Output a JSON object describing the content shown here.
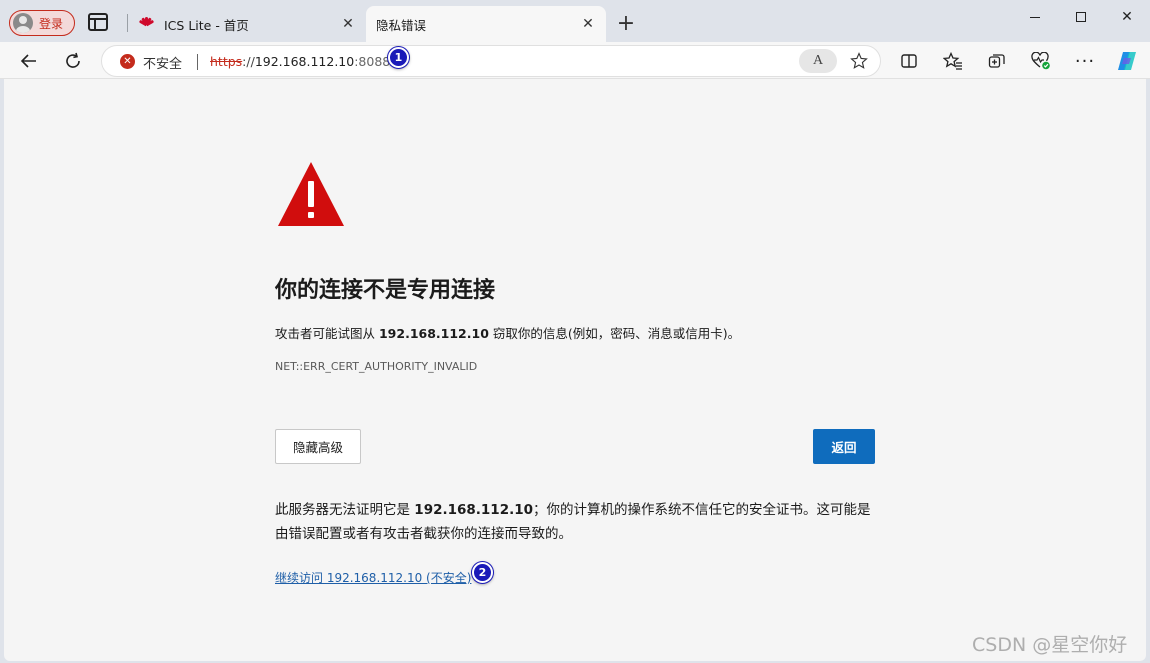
{
  "profile": {
    "label": "登录"
  },
  "tabs": [
    {
      "title": "ICS Lite - 首页",
      "close": "✕"
    },
    {
      "title": "隐私错误",
      "close": "✕"
    }
  ],
  "new_tab": "+",
  "window": {
    "close": "✕"
  },
  "address_bar": {
    "security_label": "不安全",
    "security_glyph": "✕",
    "url_scheme": "https",
    "url_sep": "://",
    "url_host": "192.168.112.10",
    "url_port": ":8088",
    "read_aloud": "A"
  },
  "toolbar": {
    "more": "···"
  },
  "annotations": {
    "marker1": "1",
    "marker2": "2"
  },
  "error_page": {
    "heading": "你的连接不是专用连接",
    "description_before": "攻击者可能试图从 ",
    "description_host": "192.168.112.10",
    "description_after": " 窃取你的信息(例如，密码、消息或信用卡)。",
    "error_code": "NET::ERR_CERT_AUTHORITY_INVALID",
    "hide_advanced_button": "隐藏高级",
    "back_button": "返回",
    "explain_before": "此服务器无法证明它是 ",
    "explain_host": "192.168.112.10",
    "explain_after": "；你的计算机的操作系统不信任它的安全证书。这可能是由错误配置或者有攻击者截获你的连接而导致的。",
    "proceed_link": "继续访问 192.168.112.10 (不安全)"
  },
  "watermark": "CSDN @星空你好",
  "colors": {
    "danger": "#c42b1c",
    "primary_button": "#0f6cbd",
    "link": "#1f5fa8",
    "marker": "#1a1ab8",
    "warning_triangle": "#d10d0d"
  }
}
